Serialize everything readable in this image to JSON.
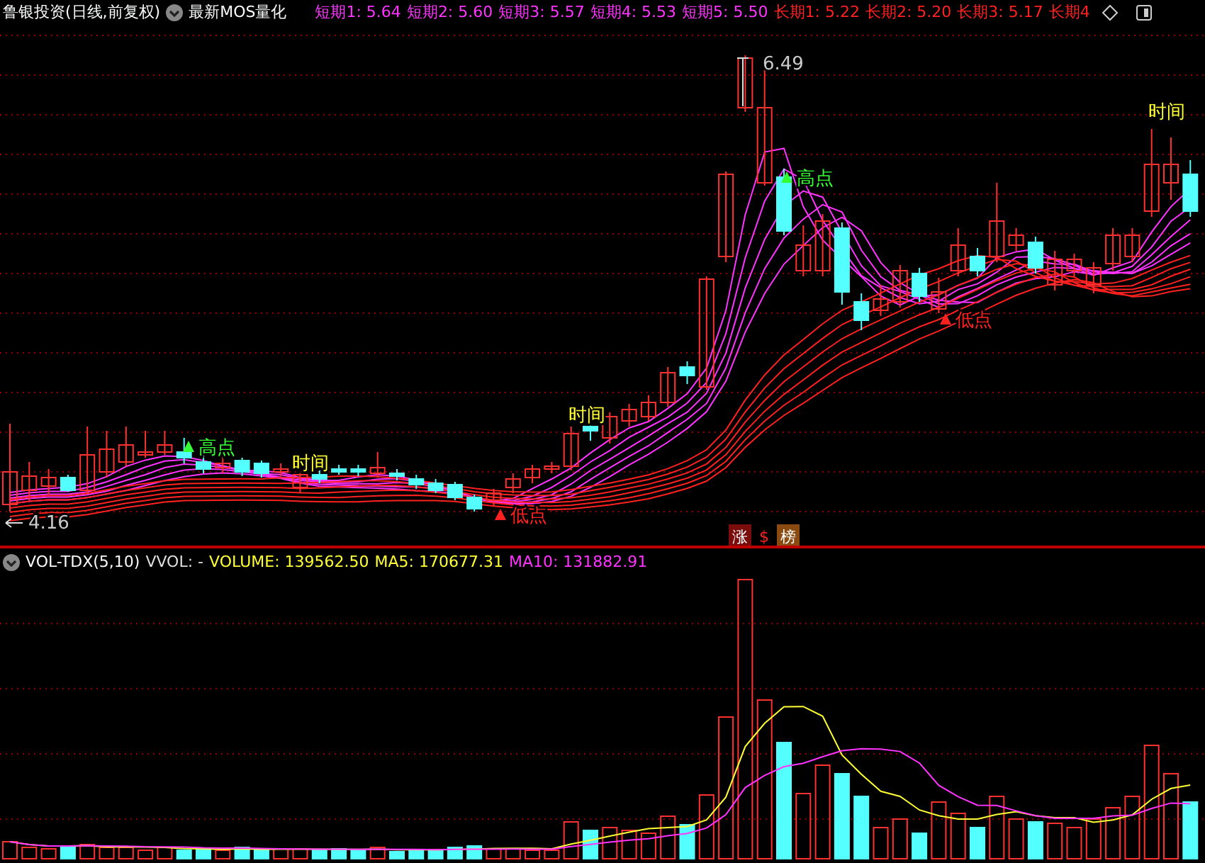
{
  "header": {
    "stock": "鲁银投资(日线,前复权)",
    "indicator": "最新MOS量化",
    "readings": [
      {
        "text": "短期1: 5.64",
        "kind": "short"
      },
      {
        "text": "短期2: 5.60",
        "kind": "short"
      },
      {
        "text": "短期3: 5.57",
        "kind": "short"
      },
      {
        "text": "短期4: 5.53",
        "kind": "short"
      },
      {
        "text": "短期5: 5.50",
        "kind": "short"
      },
      {
        "text": "长期1: 5.22",
        "kind": "long"
      },
      {
        "text": "长期2: 5.20",
        "kind": "long"
      },
      {
        "text": "长期3: 5.17",
        "kind": "long"
      },
      {
        "text": "长期4",
        "kind": "long"
      }
    ]
  },
  "price_chart": {
    "annotations": [
      {
        "text": "6.49",
        "kind": "price"
      },
      {
        "text": "4.16",
        "kind": "price"
      },
      {
        "text": "高点",
        "kind": "peak"
      },
      {
        "text": "高点",
        "kind": "peak"
      },
      {
        "text": "低点",
        "kind": "trough"
      },
      {
        "text": "低点",
        "kind": "trough"
      },
      {
        "text": "时间",
        "kind": "time"
      },
      {
        "text": "时间",
        "kind": "time"
      },
      {
        "text": "时间",
        "kind": "time"
      }
    ],
    "badges": [
      {
        "text": "涨",
        "kind": "boxed",
        "color": "#7a0c0c"
      },
      {
        "text": "$",
        "kind": "plain",
        "color": "#ff2020"
      },
      {
        "text": "榜",
        "kind": "boxed",
        "color": "#8a4a10"
      }
    ]
  },
  "volume_panel": {
    "name": "VOL-TDX(5,10)",
    "readings": [
      {
        "text": "VVOL: -",
        "kind": "plain"
      },
      {
        "text": "VOLUME: 139562.50",
        "kind": "volume"
      },
      {
        "text": "MA5: 170677.31",
        "kind": "ma5"
      },
      {
        "text": "MA10: 131882.91",
        "kind": "ma10"
      }
    ]
  }
}
